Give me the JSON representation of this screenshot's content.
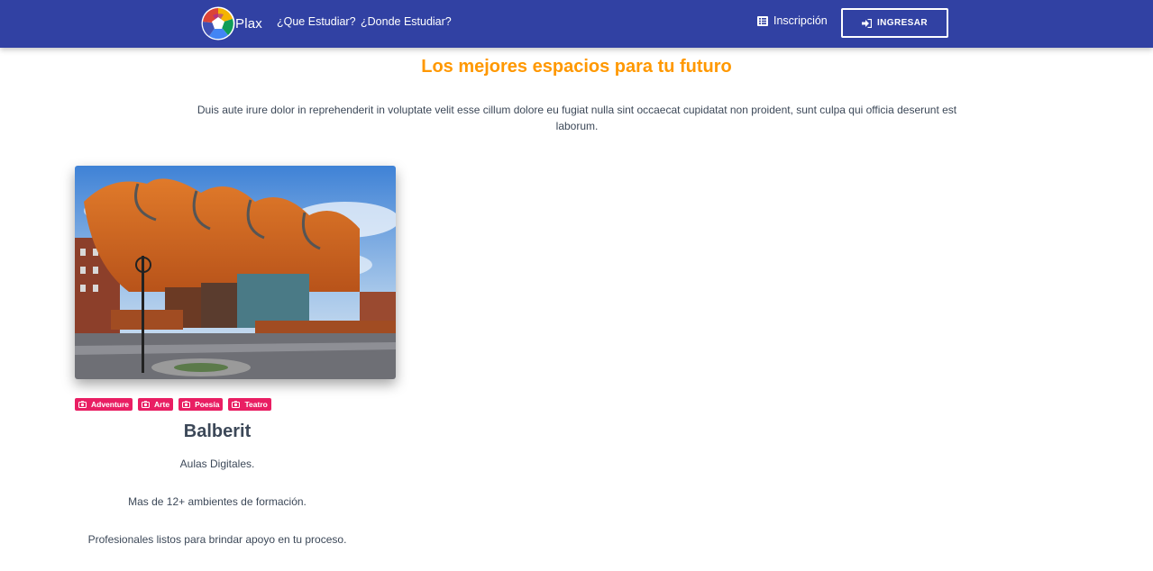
{
  "navbar": {
    "brand": "Plax",
    "links": [
      "¿Que Estudiar?",
      "¿Donde Estudiar?"
    ],
    "inscripcion": "Inscripción",
    "ingresar": "INGRESAR",
    "color": "#3141a3"
  },
  "section": {
    "title": "Los mejores espacios para tu futuro",
    "description": "Duis aute irure dolor in reprehenderit in voluptate velit esse cillum dolore eu fugiat nulla sint occaecat cupidatat non proident, sunt culpa qui officia deserunt est laborum.",
    "accent": "#ff9800"
  },
  "card": {
    "image_icon": "building-photo",
    "tags": [
      "Adventure",
      "Arte",
      "Poesía",
      "Teatro"
    ],
    "tag_color": "#e91e63",
    "title": "Balberit",
    "lines": [
      "Aulas Digitales.",
      "Mas de 12+ ambientes de formación.",
      "Profesionales listos para brindar apoyo en tu proceso."
    ]
  }
}
